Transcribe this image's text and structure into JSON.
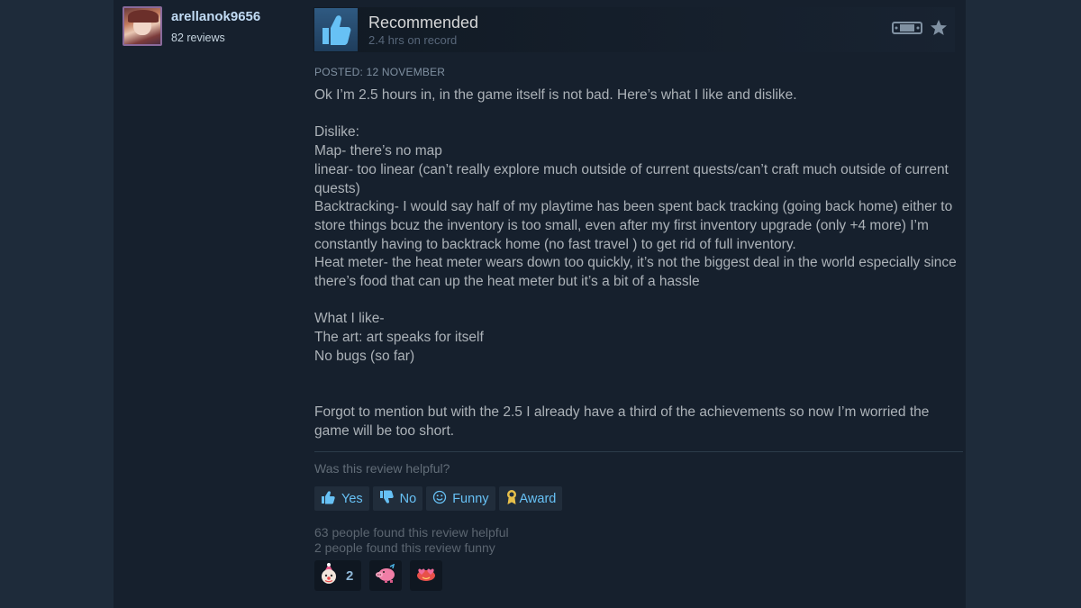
{
  "author": {
    "name": "arellanok9656",
    "reviews": "82 reviews"
  },
  "review": {
    "verdict": "Recommended",
    "hours": "2.4 hrs on record",
    "posted": "POSTED: 12 NOVEMBER",
    "lines": [
      "Ok I’m 2.5 hours in, in the game itself is not bad. Here’s what I like and dislike.",
      "",
      "Dislike:",
      "Map- there’s no map",
      "linear- too linear (can’t really explore much outside of current quests/can’t craft much outside of current quests)",
      "Backtracking- I would say half of my playtime has been spent back tracking (going back home) either to store things bcuz the inventory is too small, even after my first inventory upgrade (only +4 more) I’m constantly having to backtrack home (no fast travel ) to get rid of full inventory.",
      "Heat meter- the heat meter wears down too quickly, it’s not the biggest deal in the world especially since there’s food that can up the heat meter but it’s a bit of a hassle",
      "",
      "What I like-",
      "The art: art speaks for itself",
      "No bugs (so far)",
      "",
      "",
      "Forgot to mention but with the 2.5 I already have a third of the achievements so now I’m worried the game will be too short."
    ]
  },
  "helpful": {
    "question": "Was this review helpful?",
    "buttons": {
      "yes": "Yes",
      "no": "No",
      "funny": "Funny",
      "award": "Award"
    },
    "helpful_count": "63 people found this review helpful",
    "funny_count": "2 people found this review funny"
  },
  "awards": [
    {
      "icon": "clown-award-icon",
      "count": "2"
    },
    {
      "icon": "pig-award-icon",
      "count": ""
    },
    {
      "icon": "heart-eyes-award-icon",
      "count": ""
    }
  ],
  "colors": {
    "background": "#1b2838",
    "card": "#16202d",
    "link": "#67c1f5",
    "text": "#acb2b8"
  }
}
